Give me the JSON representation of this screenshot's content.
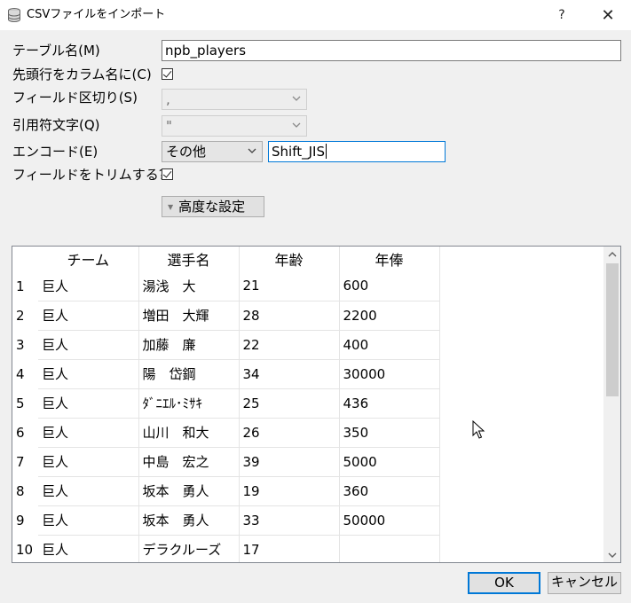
{
  "window": {
    "title": "CSVファイルをインポート",
    "help_label": "?",
    "close_label": "✕"
  },
  "form": {
    "table_name_label": "テーブル名(M)",
    "table_name_value": "npb_players",
    "header_row_label": "先頭行をカラム名に(C)",
    "header_row_checked": true,
    "field_sep_label": "フィールド区切り(S)",
    "field_sep_value": ",",
    "quote_label": "引用符文字(Q)",
    "quote_value": "\"",
    "encoding_label": "エンコード(E)",
    "encoding_select": "その他",
    "encoding_value": "Shift_JIS",
    "trim_label": "フィールドをトリムする?",
    "trim_checked": true,
    "advanced_label": "高度な設定"
  },
  "grid": {
    "columns": [
      "チーム",
      "選手名",
      "年齢",
      "年俸"
    ],
    "rows": [
      {
        "n": "1",
        "team": "巨人",
        "name": "湯浅　大",
        "age": "21",
        "salary": "600"
      },
      {
        "n": "2",
        "team": "巨人",
        "name": "増田　大輝",
        "age": "28",
        "salary": "2200"
      },
      {
        "n": "3",
        "team": "巨人",
        "name": "加藤　廉",
        "age": "22",
        "salary": "400"
      },
      {
        "n": "4",
        "team": "巨人",
        "name": "陽　岱鋼",
        "age": "34",
        "salary": "30000"
      },
      {
        "n": "5",
        "team": "巨人",
        "name": "ﾀﾞﾆｴﾙ･ﾐｻｷ",
        "age": "25",
        "salary": "436"
      },
      {
        "n": "6",
        "team": "巨人",
        "name": "山川　和大",
        "age": "26",
        "salary": "350"
      },
      {
        "n": "7",
        "team": "巨人",
        "name": "中島　宏之",
        "age": "39",
        "salary": "5000"
      },
      {
        "n": "8",
        "team": "巨人",
        "name": "坂本　勇人",
        "age": "19",
        "salary": "360"
      },
      {
        "n": "9",
        "team": "巨人",
        "name": "坂本　勇人",
        "age": "33",
        "salary": "50000"
      },
      {
        "n": "10",
        "team": "巨人",
        "name": "デラクルーズ",
        "age": "17",
        "salary": ""
      }
    ]
  },
  "buttons": {
    "ok_label": "OK",
    "cancel_label": "キャンセル"
  },
  "icons": {
    "app": "database-icon",
    "cursor": "mouse-pointer-icon"
  }
}
